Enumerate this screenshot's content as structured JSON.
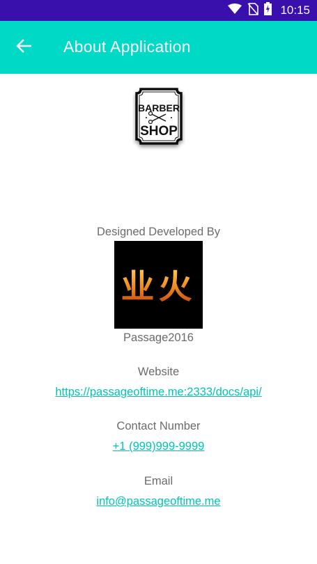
{
  "status_bar": {
    "time": "10:15",
    "icons": [
      "wifi-icon",
      "no-sim-icon",
      "battery-charging-icon"
    ],
    "background": "#3a10ad"
  },
  "app_bar": {
    "title": "About Application",
    "back_icon": "arrow-back-icon",
    "background": "#00d9c6"
  },
  "logo": {
    "line1": "BARBER",
    "line2": "SHOP",
    "icon": "scissors-icon"
  },
  "developer": {
    "label": "Designed Developed By",
    "image_text": "业火",
    "name": "Passage2016"
  },
  "website": {
    "label": "Website",
    "url": "https://passageoftime.me:2333/docs/api/"
  },
  "contact": {
    "label": "Contact Number",
    "phone": "+1 (999)999-9999"
  },
  "email": {
    "label": "Email",
    "address": "info@passageoftime.me"
  },
  "colors": {
    "accent": "#00d9c6",
    "link": "#00c5b4",
    "text_secondary": "#6b6b6b"
  }
}
